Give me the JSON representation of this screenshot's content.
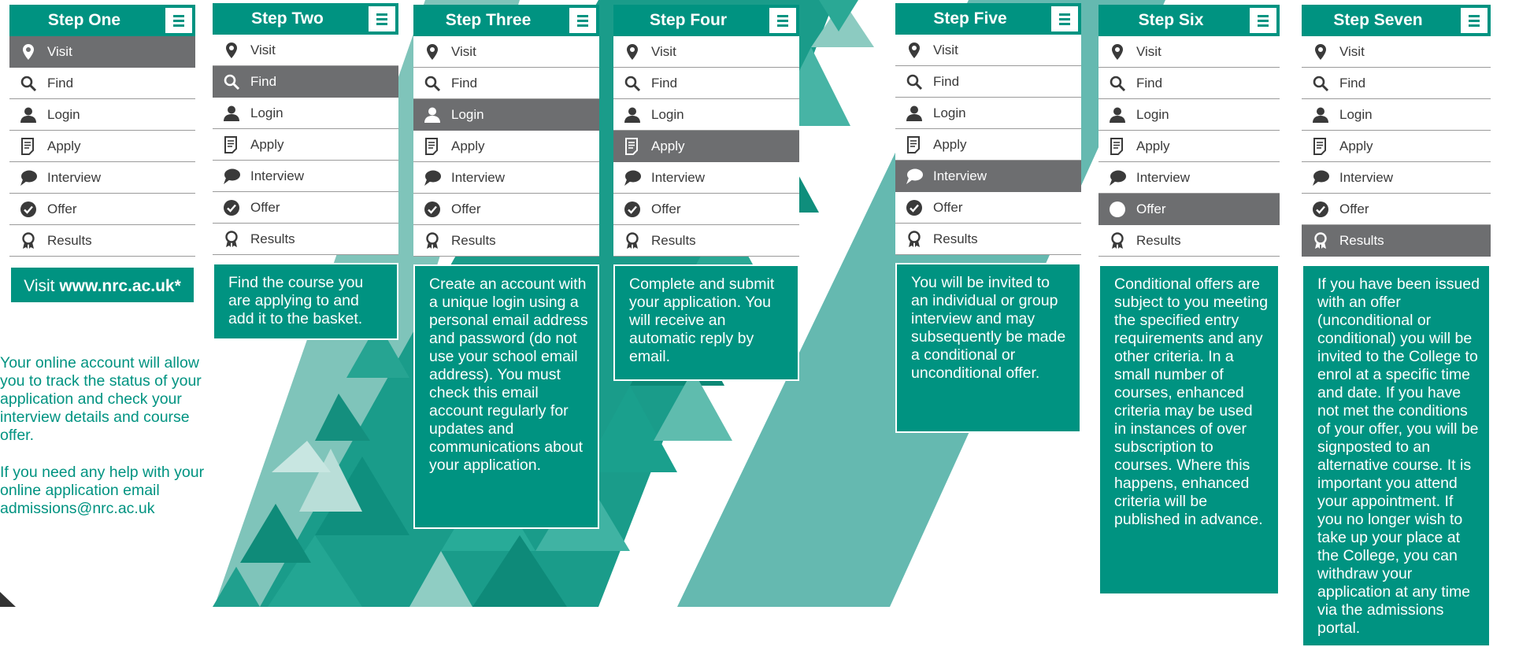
{
  "colors": {
    "teal": "#009381",
    "grey": "#6d6e70",
    "light_teal": "#65b9b0"
  },
  "menu_labels": [
    "Visit",
    "Find",
    "Login",
    "Apply",
    "Interview",
    "Offer",
    "Results"
  ],
  "icons": [
    "map-pin-icon",
    "magnifier-icon",
    "user-icon",
    "document-icon",
    "speech-bubble-icon",
    "checkmark-icon",
    "rosette-icon"
  ],
  "steps": [
    {
      "title": "Step One",
      "active": 0,
      "desc_prefix": "Visit ",
      "desc_bold": "www.nrc.ac.uk*"
    },
    {
      "title": "Step Two",
      "active": 1,
      "desc": "Find the course you are applying to and add it to the basket."
    },
    {
      "title": "Step Three",
      "active": 2,
      "desc": "Create an account with a unique login using a personal email address and password (do not use your school email address).  You must check this email account regularly for updates and communications about your application."
    },
    {
      "title": "Step Four",
      "active": 3,
      "desc": "Complete and submit your application. You will receive an automatic reply by email."
    },
    {
      "title": "Step Five",
      "active": 4,
      "desc": "You will be invited to an individual or group interview and may subsequently be made a conditional or unconditional offer."
    },
    {
      "title": "Step Six",
      "active": 5,
      "desc": "Conditional offers are subject to you meeting the specified entry requirements and any other criteria.  In a small number of courses, enhanced criteria may be used in instances of over subscription to courses.  Where this happens, enhanced criteria will be published in advance."
    },
    {
      "title": "Step Seven",
      "active": 6,
      "desc": "If you have been issued with an offer (unconditional or conditional) you will be invited to the College to enrol at a specific time and date. If you have not met the conditions of your offer, you will be signposted to an alternative course.  It is important you attend your appointment. If you no longer wish to take up your place at the College, you can withdraw your application at any time via the admissions portal."
    }
  ],
  "side_notes": {
    "tracking": "Your online account will allow you to track the status of your application and check your interview details and course offer.",
    "help": "If you need any help with your online application email admissions@nrc.ac.uk"
  }
}
